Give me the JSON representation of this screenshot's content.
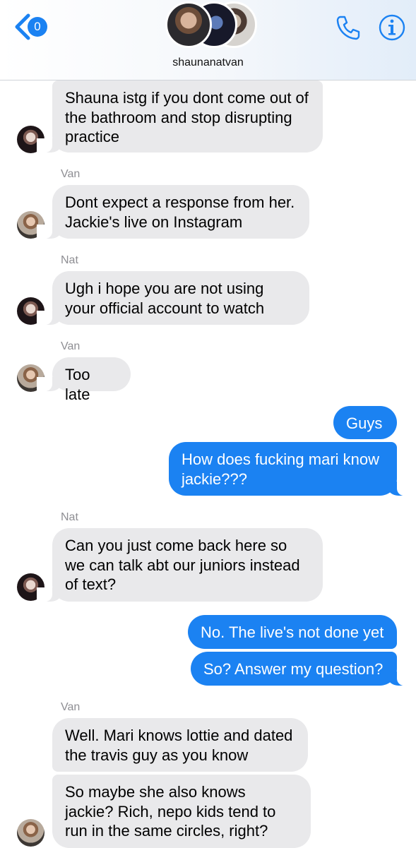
{
  "header": {
    "back_badge_count": "0",
    "group_name": "shaunanatvan",
    "icons": {
      "back": "chevron-left-icon",
      "call": "phone-icon",
      "info": "info-icon"
    },
    "accent_color": "#1b82f2"
  },
  "messages": [
    {
      "sender": "",
      "text": "Shauna istg if you dont come out of the bathroom and stop disrupting practice",
      "direction": "incoming"
    },
    {
      "sender": "Van",
      "text": "Dont expect a response from her. Jackie's live on Instagram",
      "direction": "incoming"
    },
    {
      "sender": "Nat",
      "text": "Ugh i hope you are not using your official account to watch",
      "direction": "incoming"
    },
    {
      "sender": "Van",
      "text": "Too late",
      "direction": "incoming"
    },
    {
      "sender": "",
      "text": "Guys",
      "direction": "outgoing"
    },
    {
      "sender": "",
      "text": "How does fucking mari know jackie???",
      "direction": "outgoing"
    },
    {
      "sender": "Nat",
      "text": "Can you just come back here so we can talk abt our juniors instead of text?",
      "direction": "incoming"
    },
    {
      "sender": "",
      "text": "No. The live's not done yet",
      "direction": "outgoing"
    },
    {
      "sender": "",
      "text": "So? Answer my question?",
      "direction": "outgoing"
    },
    {
      "sender": "Van",
      "text": "Well. Mari knows lottie and dated the travis guy as you know",
      "direction": "incoming"
    },
    {
      "sender": "",
      "text": "So maybe she also knows jackie? Rich, nepo kids tend to run in the same circles, right?",
      "direction": "incoming"
    }
  ],
  "colors": {
    "incoming_bubble": "#e9e9eb",
    "outgoing_bubble": "#1b82f2",
    "sender_label": "#8e8e93"
  }
}
